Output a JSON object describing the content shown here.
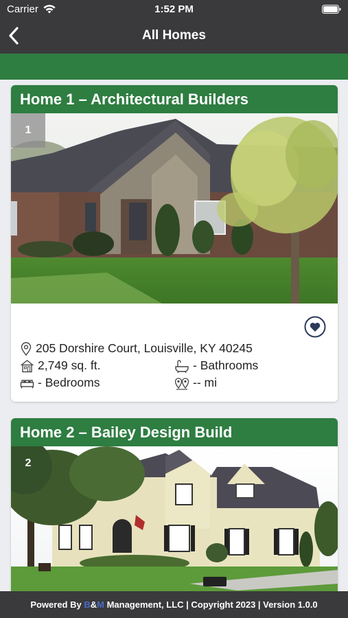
{
  "status": {
    "carrier": "Carrier",
    "time": "1:52 PM"
  },
  "nav": {
    "title": "All Homes"
  },
  "homes": [
    {
      "title": "Home 1 – Architectural Builders",
      "number": "1",
      "address": "205 Dorshire Court, Louisville, KY 40245",
      "sqft": "2,749 sq. ft.",
      "bathrooms": "- Bathrooms",
      "bedrooms": "- Bedrooms",
      "distance": "-- mi"
    },
    {
      "title": "Home 2 – Bailey Design Build",
      "number": "2"
    }
  ],
  "footer": {
    "prefix": "Powered By ",
    "brand_b": "B",
    "brand_amp": "&",
    "brand_m": "M",
    "suffix": " Management, LLC | Copyright 2023 | Version 1.0.0"
  },
  "colors": {
    "header_green": "#2e7d41",
    "bar_dark": "#3a3a3c",
    "heart_navy": "#2b3a5a"
  },
  "icons": [
    "wifi-icon",
    "battery-icon",
    "back-chevron-icon",
    "heart-icon",
    "location-pin-icon",
    "house-icon",
    "bathtub-icon",
    "bed-icon",
    "distance-pins-icon"
  ]
}
